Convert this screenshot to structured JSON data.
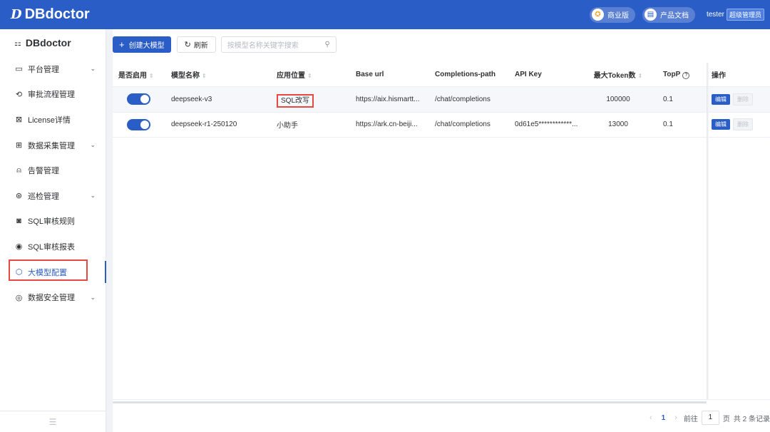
{
  "app": {
    "logo_mark": "D",
    "logo_text": "DBdoctor"
  },
  "header": {
    "commercial_label": "商业版",
    "docs_label": "产品文档",
    "username": "tester",
    "role": "超级管理员"
  },
  "sidebar": {
    "title": "DBdoctor",
    "items": [
      {
        "label": "平台管理",
        "icon": "monitor-icon",
        "has_arrow": true
      },
      {
        "label": "审批流程管理",
        "icon": "flow-icon",
        "has_arrow": false
      },
      {
        "label": "License详情",
        "icon": "license-icon",
        "has_arrow": false
      },
      {
        "label": "数据采集管理",
        "icon": "collect-icon",
        "has_arrow": true
      },
      {
        "label": "告警管理",
        "icon": "alarm-icon",
        "has_arrow": false
      },
      {
        "label": "巡检管理",
        "icon": "inspect-icon",
        "has_arrow": true
      },
      {
        "label": "SQL审核规则",
        "icon": "rule-icon",
        "has_arrow": false
      },
      {
        "label": "SQL审核报表",
        "icon": "report-icon",
        "has_arrow": false
      },
      {
        "label": "大模型配置",
        "icon": "cube-icon",
        "has_arrow": false,
        "active": true
      },
      {
        "label": "数据安全管理",
        "icon": "security-icon",
        "has_arrow": true
      }
    ]
  },
  "toolbar": {
    "create_label": "创建大模型",
    "refresh_label": "刷新",
    "search_placeholder": "按模型名称关键字搜索"
  },
  "table": {
    "headers": {
      "enabled": "是否启用",
      "model_name": "模型名称",
      "position": "应用位置",
      "base_url": "Base url",
      "completions_path": "Completions-path",
      "api_key": "API Key",
      "max_token": "最大Token数",
      "top_p": "TopP",
      "actions": "操作"
    },
    "rows": [
      {
        "enabled": true,
        "model_name": "deepseek-v3",
        "position": "SQL改写",
        "base_url": "https://aix.hismartt...",
        "completions_path": "/chat/completions",
        "api_key": "",
        "max_token": "100000",
        "top_p": "0.1",
        "edit": "编辑",
        "delete": "删除"
      },
      {
        "enabled": true,
        "model_name": "deepseek-r1-250120",
        "position": "小助手",
        "base_url": "https://ark.cn-beiji...",
        "completions_path": "/chat/completions",
        "api_key": "0d61e5************...",
        "max_token": "13000",
        "top_p": "0.1",
        "edit": "编辑",
        "delete": "删除"
      }
    ]
  },
  "pagination": {
    "current_page": "1",
    "goto_label": "前往",
    "goto_value": "1",
    "page_unit": "页",
    "total_label": "共 2 条记录"
  },
  "colors": {
    "primary": "#2b5dc6",
    "highlight_box": "#e8483f"
  }
}
